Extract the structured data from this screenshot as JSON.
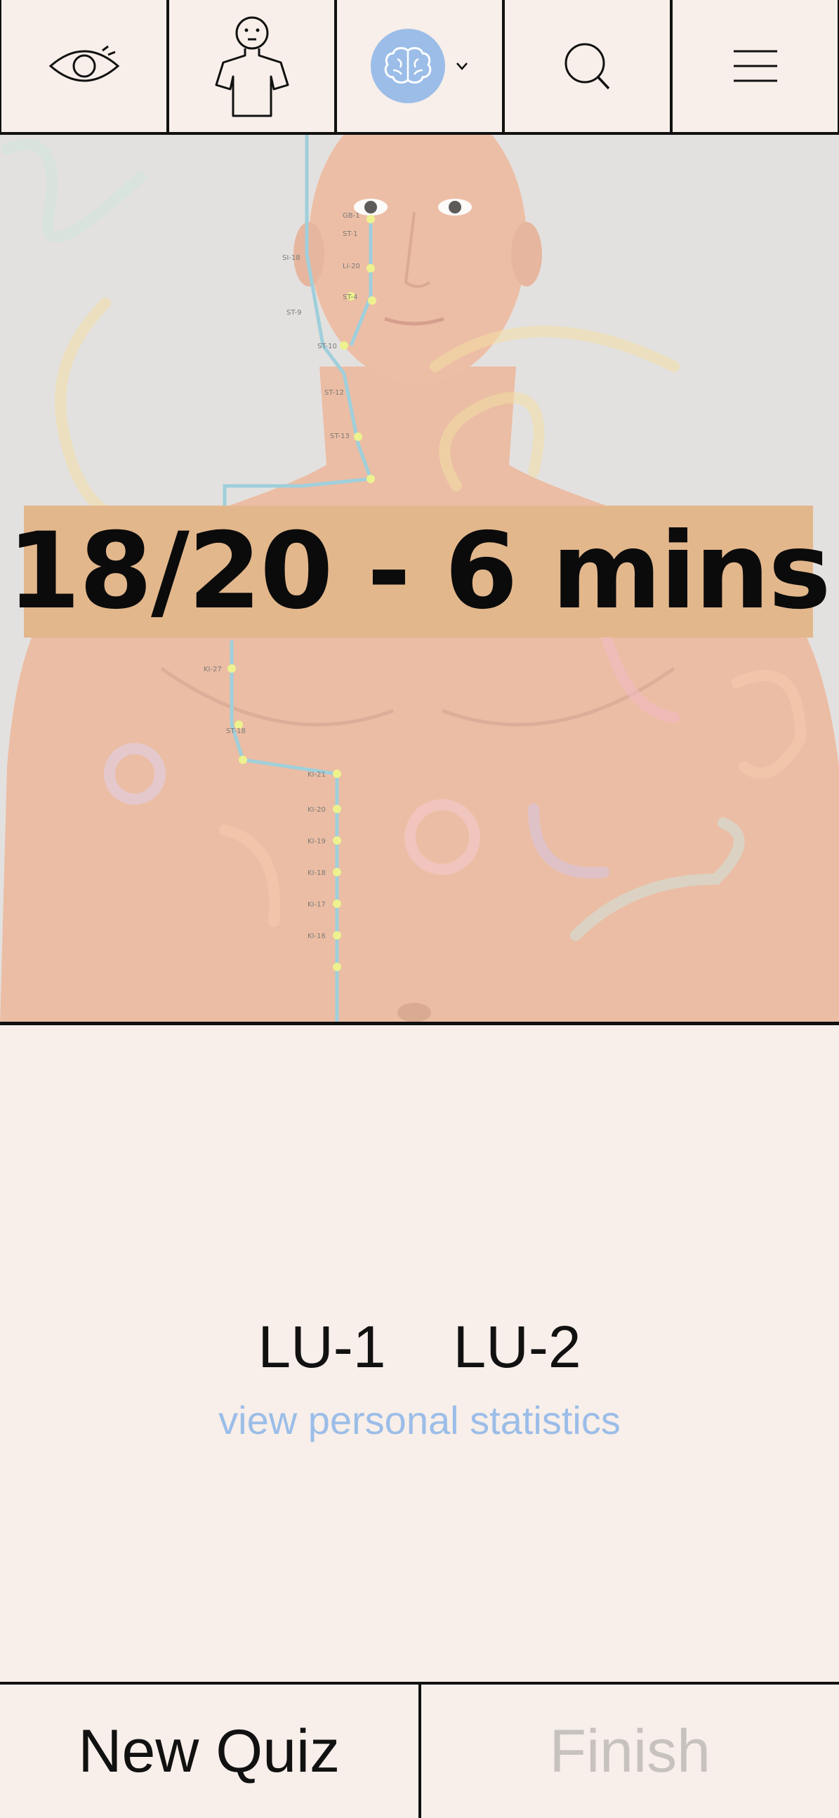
{
  "toolbar": {
    "items": [
      {
        "icon": "eye-icon"
      },
      {
        "icon": "body-figure-icon"
      },
      {
        "icon": "brain-icon",
        "has_dropdown": true
      },
      {
        "icon": "search-icon"
      },
      {
        "icon": "menu-icon"
      }
    ],
    "accent_color": "#9bbde8"
  },
  "quiz": {
    "score_text": "18/20 - 6 mins",
    "banner_color": "#e3b78c",
    "point_labels": [
      "GB-1",
      "ST-1",
      "SI-18",
      "LI-20",
      "ST-4",
      "ST-9",
      "ST-10",
      "ST-12",
      "ST-13",
      "KI-27",
      "ST-18",
      "KI-21",
      "KI-20",
      "KI-19",
      "KI-18",
      "KI-17",
      "KI-16"
    ]
  },
  "answers": {
    "items": [
      "LU-1",
      "LU-2"
    ],
    "stats_link": "view personal statistics"
  },
  "bottom_bar": {
    "new_quiz": "New Quiz",
    "finish": "Finish"
  }
}
